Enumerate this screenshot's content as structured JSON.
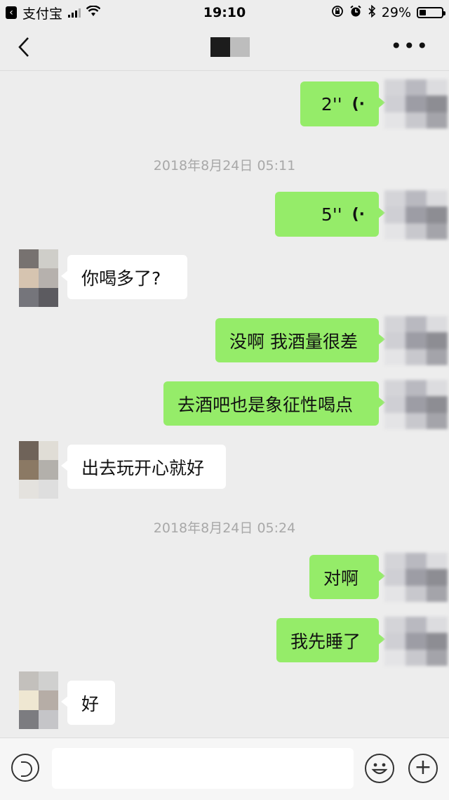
{
  "status_bar": {
    "carrier": "支付宝",
    "time": "19:10",
    "battery_percent": "29%",
    "battery_level": 0.29
  },
  "nav": {
    "back_icon": "chevron-left-icon",
    "more_icon": "more-dots-icon",
    "more_text": "•••",
    "title_blur_colors": [
      "#1c1c1c",
      "#bdbdbd"
    ]
  },
  "messages": {
    "m1": {
      "side": "me",
      "type": "voice",
      "duration": "2''"
    },
    "t1": "2018年8月24日 05:11",
    "m2": {
      "side": "me",
      "type": "voice",
      "duration": "5''"
    },
    "m3": {
      "side": "them",
      "text": "你喝多了?"
    },
    "m4": {
      "side": "me",
      "text": "没啊 我酒量很差"
    },
    "m5": {
      "side": "me",
      "text": "去酒吧也是象征性喝点"
    },
    "m6": {
      "side": "them",
      "text": "出去玩开心就好"
    },
    "t2": "2018年8月24日 05:24",
    "m7": {
      "side": "me",
      "text": "对啊"
    },
    "m8": {
      "side": "me",
      "text": "我先睡了"
    },
    "m9": {
      "side": "them",
      "text": "好"
    }
  },
  "input_bar": {
    "voice_icon": "voice-mode-icon",
    "emoji_icon": "emoji-icon",
    "plus_icon": "plus-icon",
    "input_value": "",
    "plus_text": "+"
  },
  "colors": {
    "my_bubble": "#95ec69",
    "their_bubble": "#ffffff",
    "background": "#ededed",
    "timestamp": "#a8a8a8"
  }
}
